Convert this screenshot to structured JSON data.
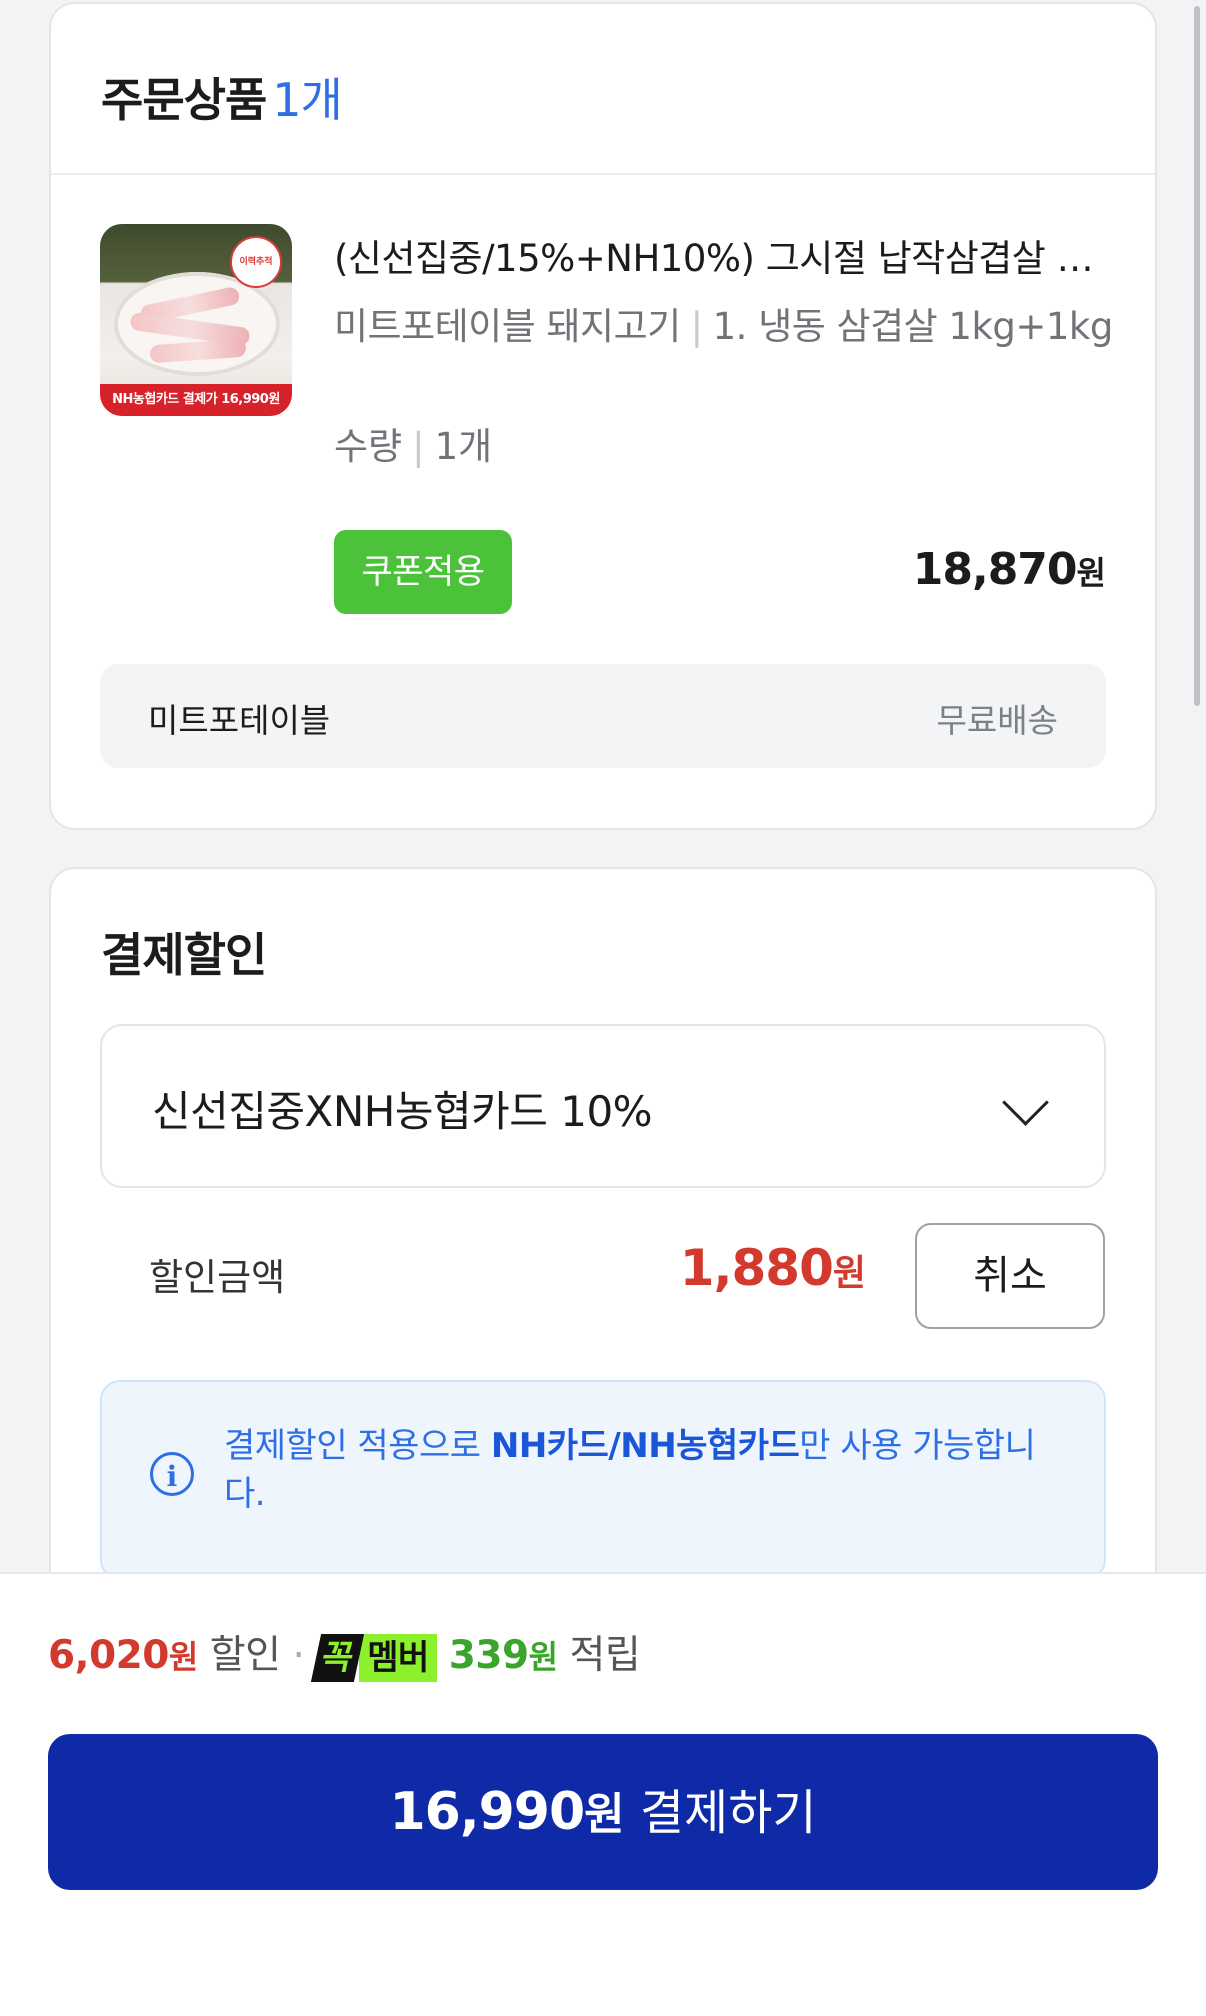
{
  "order": {
    "title": "주문상품",
    "count": "1개",
    "product": {
      "image_badge": "NH농협카드 결제가 16,990원",
      "image_logo": "이력추적",
      "title": "(신선집중/15%+NH10%) 그시절 납작삼겹살 …",
      "seller_category": "미트포테이블 돼지고기",
      "option": "1. 냉동 삼겹살 1kg+1kg",
      "qty_label": "수량",
      "qty_value": "1개",
      "coupon_button": "쿠폰적용",
      "price": "18,870",
      "price_unit": "원"
    },
    "shipping": {
      "seller": "미트포테이블",
      "fee": "무료배송"
    }
  },
  "discount": {
    "title": "결제할인",
    "selected_option": "신선집중XNH농협카드 10%",
    "amount_label": "할인금액",
    "amount": "1,880",
    "amount_unit": "원",
    "cancel_button": "취소",
    "info_prefix": "결제할인 적용으로 ",
    "info_bold": "NH카드/NH농협카드",
    "info_suffix": "만 사용 가능합니다."
  },
  "footer": {
    "discount_amount": "6,020",
    "discount_unit": "원",
    "discount_label": "할인",
    "member_badge_1": "꼭",
    "member_badge_2": "멤버",
    "points_amount": "339",
    "points_unit": "원",
    "points_label": "적립",
    "pay_amount": "16,990",
    "pay_unit": "원",
    "pay_label": "결제하기"
  },
  "colors": {
    "accent_blue": "#2f6fe4",
    "pay_button": "#0f2aa6",
    "coupon_green": "#4cc23b",
    "discount_red": "#d23a2d",
    "member_green": "#8cf02b"
  }
}
